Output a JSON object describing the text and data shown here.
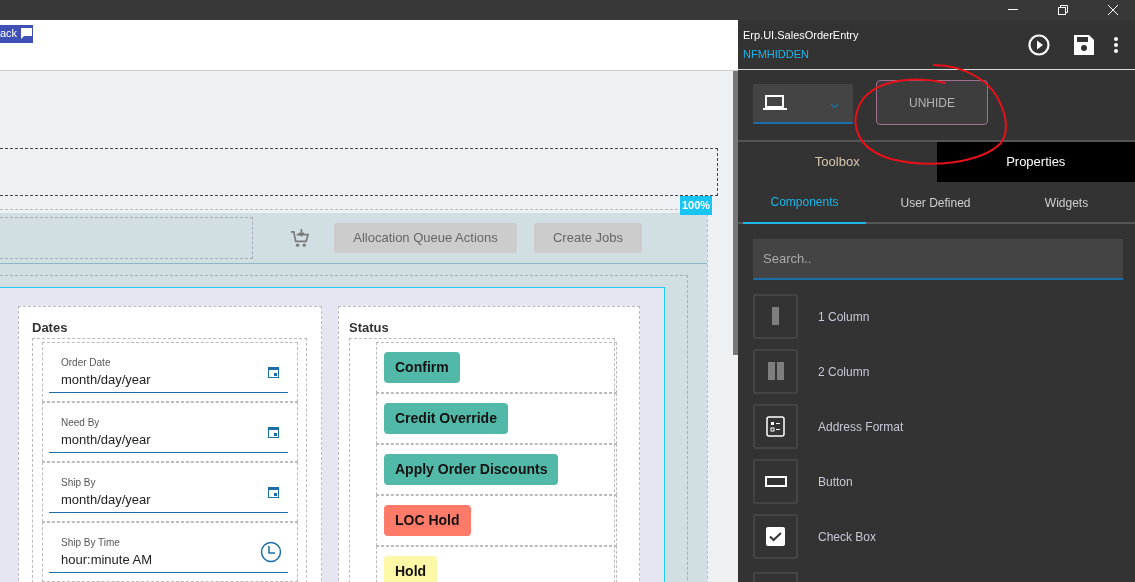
{
  "feedback_tab": {
    "label": "ack"
  },
  "canvas": {
    "zoom_badge": "100%",
    "toolbar": {
      "buttons": [
        "Allocation Queue Actions",
        "Create Jobs"
      ]
    },
    "dates_panel": {
      "title": "Dates",
      "fields": [
        {
          "label": "Order Date",
          "placeholder": "month/day/year",
          "kind": "date"
        },
        {
          "label": "Need By",
          "placeholder": "month/day/year",
          "kind": "date"
        },
        {
          "label": "Ship By",
          "placeholder": "month/day/year",
          "kind": "date"
        },
        {
          "label": "Ship By Time",
          "placeholder": "hour:minute AM",
          "kind": "time"
        }
      ]
    },
    "status_panel": {
      "title": "Status",
      "buttons": [
        {
          "label": "Confirm",
          "color": "#52b9a9"
        },
        {
          "label": "Credit Override",
          "color": "#52b9a9"
        },
        {
          "label": "Apply Order Discounts",
          "color": "#52b9a9"
        },
        {
          "label": "LOC Hold",
          "color": "#ff7a68"
        },
        {
          "label": "Hold",
          "color": "#fdf7a8"
        }
      ]
    }
  },
  "designer": {
    "title": "Erp.UI.SalesOrderEntry",
    "subtitle": "NFMHIDDEN",
    "unhide_button": "UNHIDE",
    "tabs": [
      {
        "label": "Toolbox",
        "selected": true
      },
      {
        "label": "Properties",
        "selected": false
      }
    ],
    "subtabs": [
      {
        "label": "Components",
        "selected": true
      },
      {
        "label": "User Defined",
        "selected": false
      },
      {
        "label": "Widgets",
        "selected": false
      }
    ],
    "search": {
      "placeholder": "Search.."
    },
    "components": [
      {
        "label": "1 Column",
        "kind": "one-column"
      },
      {
        "label": "2 Column",
        "kind": "two-column"
      },
      {
        "label": "Address Format",
        "kind": "address"
      },
      {
        "label": "Button",
        "kind": "button"
      },
      {
        "label": "Check Box",
        "kind": "checkbox"
      }
    ]
  }
}
